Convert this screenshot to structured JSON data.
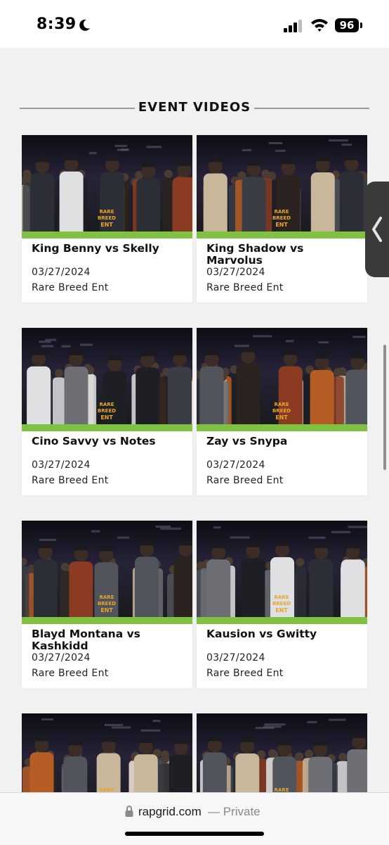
{
  "status_bar": {
    "time": "8:39",
    "battery": "96"
  },
  "section": {
    "title": "EVENT VIDEOS"
  },
  "videos": [
    {
      "title": "King Benny vs Skelly",
      "date": "03/27/2024",
      "org": "Rare Breed Ent"
    },
    {
      "title": "King Shadow vs Marvolus",
      "date": "03/27/2024",
      "org": "Rare Breed Ent"
    },
    {
      "title": "Cino Savvy vs Notes",
      "date": "03/27/2024",
      "org": "Rare Breed Ent"
    },
    {
      "title": "Zay vs Snypa",
      "date": "03/27/2024",
      "org": "Rare Breed Ent"
    },
    {
      "title": "Blayd Montana vs Kashkidd",
      "date": "03/27/2024",
      "org": "Rare Breed Ent"
    },
    {
      "title": "Kausion vs Gwitty",
      "date": "03/27/2024",
      "org": "Rare Breed Ent"
    }
  ],
  "thumbnail_logo": {
    "line1": "RARE",
    "line2": "BREED",
    "line3": "ENT"
  },
  "url_bar": {
    "domain": "rapgrid.com",
    "mode": "— Private"
  },
  "colors": {
    "accent_green": "#7fc241",
    "background": "#f1f1f1",
    "card": "#ffffff"
  },
  "icons": [
    "moon-icon",
    "signal-icon",
    "wifi-icon",
    "battery-icon",
    "chevron-left-icon",
    "lock-icon"
  ]
}
